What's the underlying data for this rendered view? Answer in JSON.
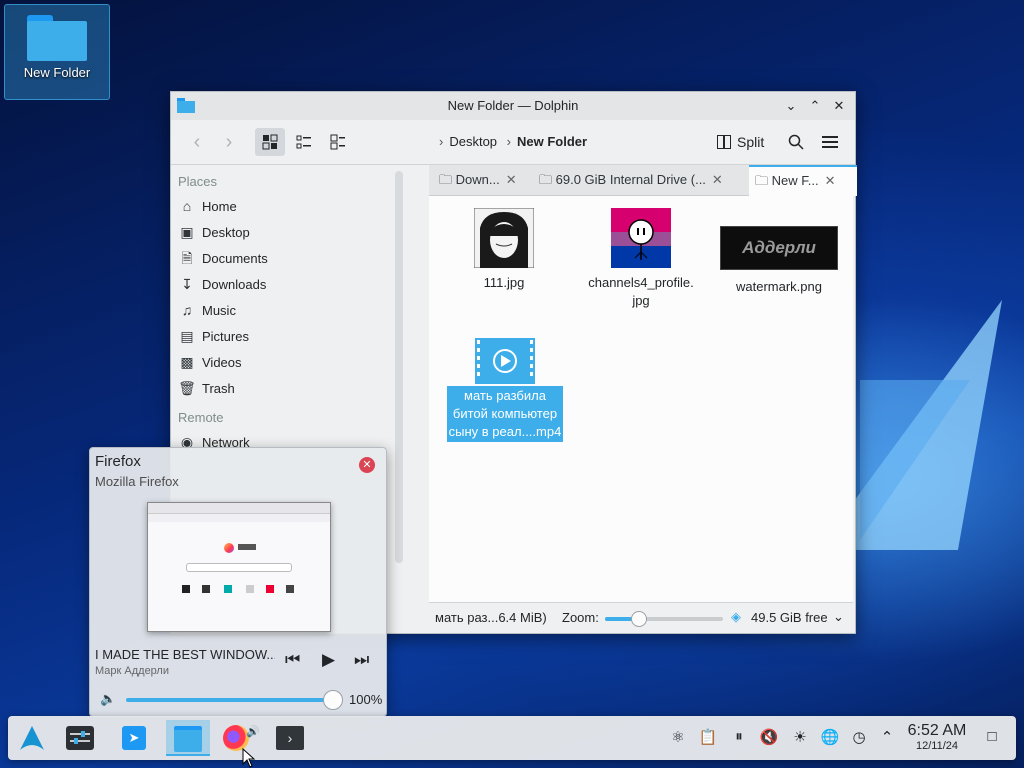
{
  "desktop": {
    "icon_label": "New Folder"
  },
  "window": {
    "title": "New Folder — Dolphin",
    "breadcrumb": [
      "Desktop",
      "New Folder"
    ],
    "split_label": "Split",
    "places_header": "Places",
    "places": [
      "Home",
      "Desktop",
      "Documents",
      "Downloads",
      "Music",
      "Pictures",
      "Videos",
      "Trash"
    ],
    "remote_header": "Remote",
    "remote_items": [
      "Network"
    ],
    "tabs": [
      "Down...",
      "69.0 GiB Internal Drive (...",
      "New F..."
    ],
    "files": [
      {
        "name": "111.jpg"
      },
      {
        "name": "channels4_profile.\njpg"
      },
      {
        "name": "watermark.png",
        "thumb_text": "Аддерли"
      },
      {
        "name": "мать разбила\nбитой компьютер\nсыну в реал....mp4"
      }
    ],
    "status": {
      "file_info": "мать раз...6.4 MiB)",
      "zoom_label": "Zoom:",
      "zoom_level": 0.28,
      "free_space": "49.5 GiB free"
    }
  },
  "tooltip": {
    "title": "Firefox",
    "subtitle": "Mozilla Firefox",
    "media_title": "I MADE THE BEST WINDOW...",
    "media_artist": "Марк Аддерли",
    "volume": "100%"
  },
  "taskbar": {
    "time": "6:52 AM",
    "date": "12/11/24"
  },
  "colors": {
    "accent": "#3daee9",
    "close": "#da4453"
  }
}
